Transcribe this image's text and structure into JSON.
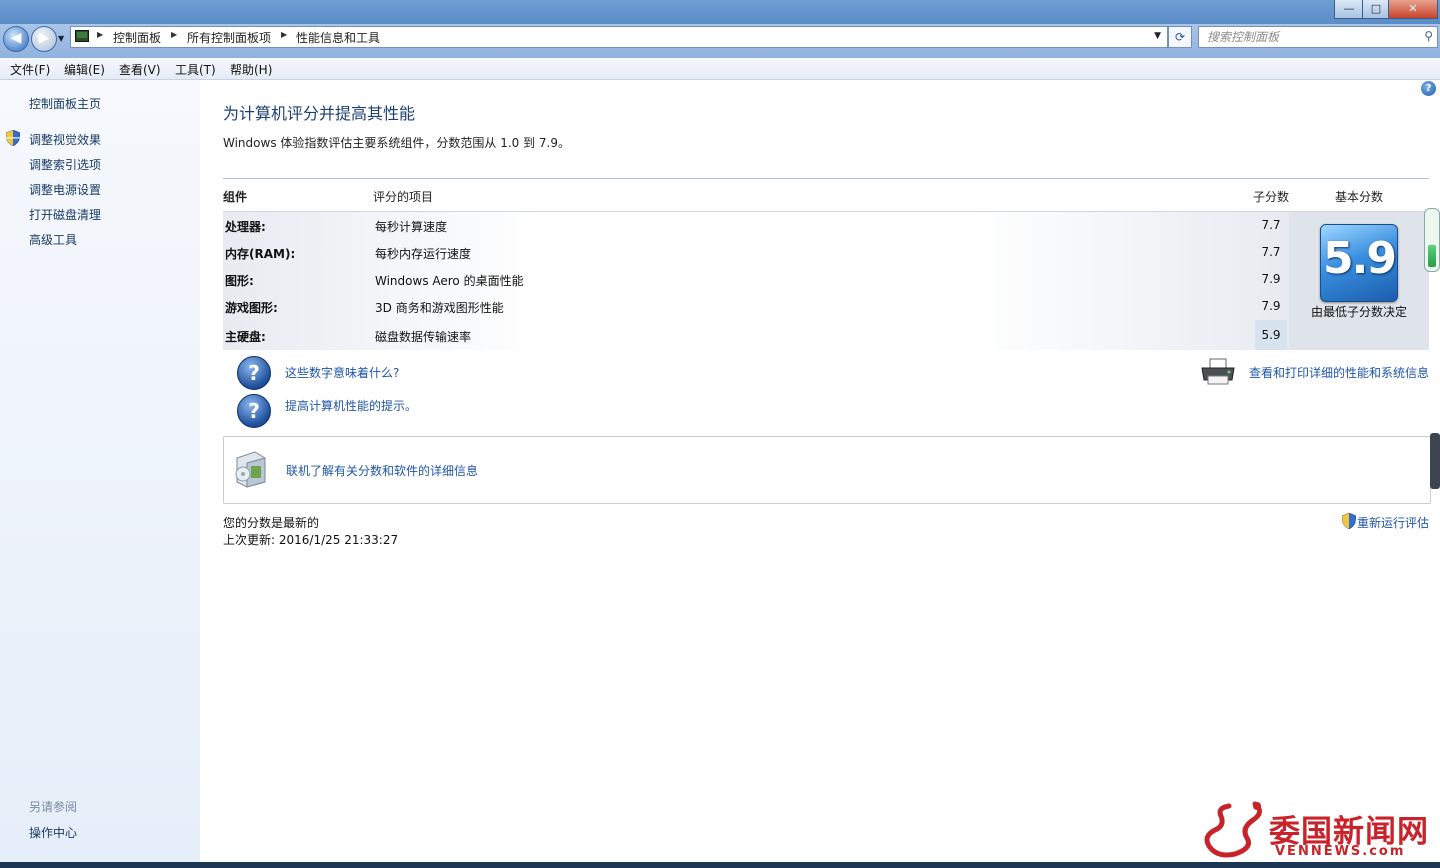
{
  "window": {
    "minimize": "—",
    "maximize": "□",
    "close": "✕"
  },
  "address": {
    "crumbs": [
      "控制面板",
      "所有控制面板项",
      "性能信息和工具"
    ]
  },
  "search": {
    "placeholder": "搜索控制面板"
  },
  "menu": [
    "文件(F)",
    "编辑(E)",
    "查看(V)",
    "工具(T)",
    "帮助(H)"
  ],
  "sidebar": {
    "home": "控制面板主页",
    "items": [
      "调整视觉效果",
      "调整索引选项",
      "调整电源设置",
      "打开磁盘清理",
      "高级工具"
    ],
    "see_also_title": "另请参阅",
    "see_also_items": [
      "操作中心"
    ]
  },
  "main": {
    "title": "为计算机评分并提高其性能",
    "subtitle": "Windows 体验指数评估主要系统组件，分数范围从 1.0 到 7.9。",
    "table": {
      "headers": {
        "component": "组件",
        "rated": "评分的项目",
        "subscore": "子分数",
        "base": "基本分数"
      },
      "rows": [
        {
          "component": "处理器:",
          "item": "每秒计算速度",
          "subscore": "7.7"
        },
        {
          "component": "内存(RAM):",
          "item": "每秒内存运行速度",
          "subscore": "7.7"
        },
        {
          "component": "图形:",
          "item": "Windows Aero 的桌面性能",
          "subscore": "7.9"
        },
        {
          "component": "游戏图形:",
          "item": "3D 商务和游戏图形性能",
          "subscore": "7.9"
        },
        {
          "component": "主硬盘:",
          "item": "磁盘数据传输速率",
          "subscore": "5.9"
        }
      ],
      "base_score": "5.9",
      "base_caption": "由最低子分数决定"
    },
    "links": {
      "what_numbers_mean": "这些数字意味着什么?",
      "tips": "提高计算机性能的提示。",
      "print_details": "查看和打印详细的性能和系统信息",
      "online_info": "联机了解有关分数和软件的详细信息"
    },
    "status": {
      "current": "您的分数是最新的",
      "last_update": "上次更新: 2016/1/25 21:33:27",
      "rerun": "重新运行评估"
    }
  },
  "watermark": {
    "text": "委国新闻网",
    "url": "VENNEWS.com"
  },
  "colors": {
    "link": "#1f55a8",
    "title": "#1e3f74",
    "nav_bg": "#e6eef9",
    "score_tile": "#3a8ee0"
  }
}
